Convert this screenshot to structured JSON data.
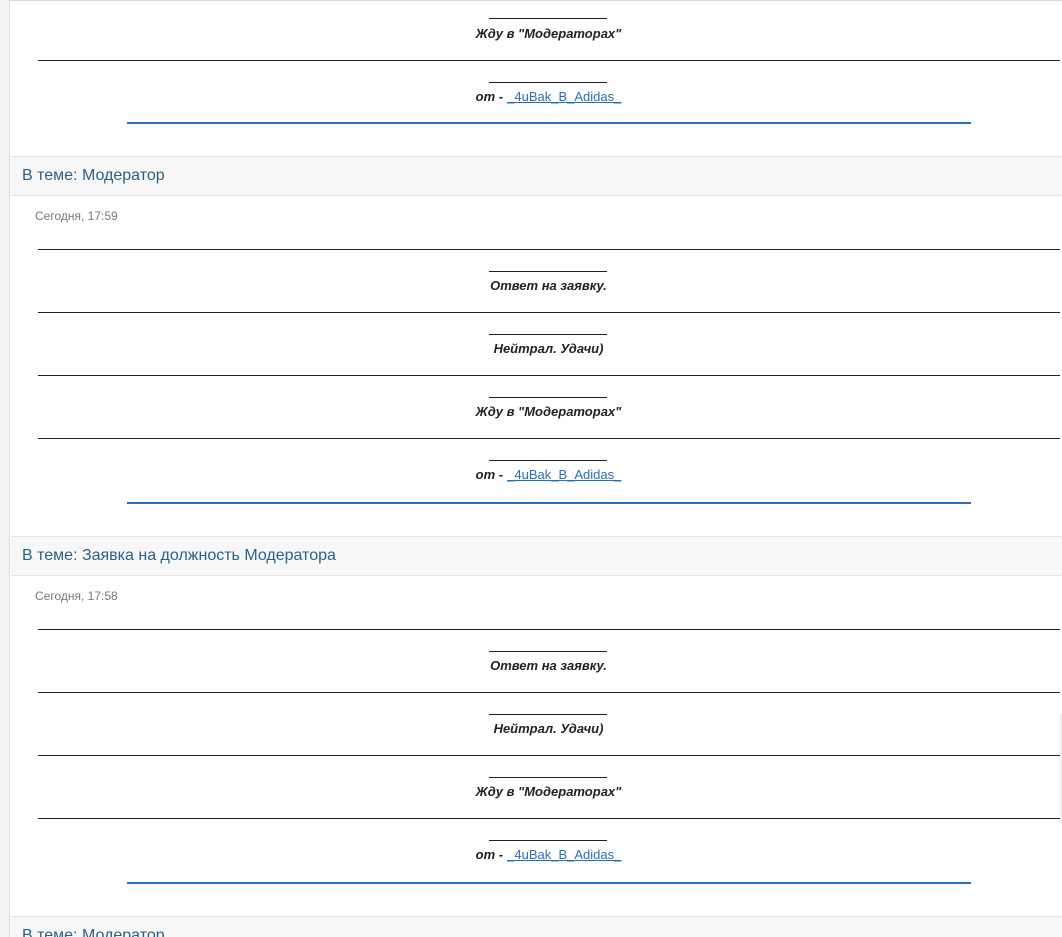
{
  "posts": [
    {
      "topic_prefix": "",
      "topic": "",
      "time": "",
      "lines": [
        "Жду в \"Модераторах\""
      ],
      "signature_prefix": "от -",
      "signature_author": "_4uBak_B_Adidas_"
    },
    {
      "topic_prefix": "В теме: ",
      "topic": "Модератор",
      "time": "Сегодня, 17:59",
      "lines": [
        "Ответ на заявку.",
        "Нейтрал. Удачи)",
        "Жду в \"Модераторах\""
      ],
      "signature_prefix": "от -",
      "signature_author": "_4uBak_B_Adidas_"
    },
    {
      "topic_prefix": "В теме: ",
      "topic": "Заявка на должность Модератора",
      "time": "Сегодня, 17:58",
      "lines": [
        "Ответ на заявку.",
        "Нейтрал. Удачи)",
        "Жду в \"Модераторах\""
      ],
      "signature_prefix": "от -",
      "signature_author": "_4uBak_B_Adidas_"
    },
    {
      "topic_prefix": "В теме: ",
      "topic": "Модератор"
    }
  ]
}
